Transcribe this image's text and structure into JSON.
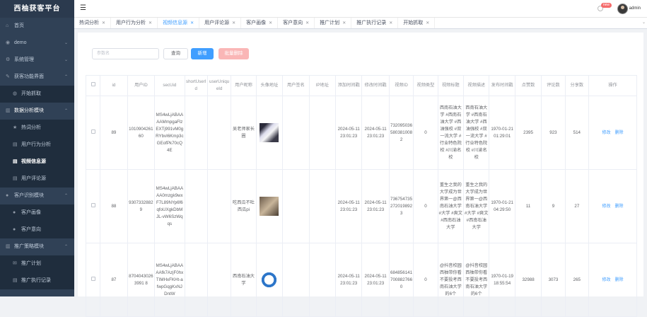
{
  "app": {
    "title": "西柚获客平台"
  },
  "sidebar": {
    "items": [
      {
        "label": "首页",
        "icon": "home-icon"
      },
      {
        "label": "demo",
        "icon": "dashboard-icon",
        "arrow": "⌄"
      },
      {
        "label": "系统管理",
        "icon": "gear-icon",
        "arrow": "⌄"
      },
      {
        "label": "获客功能界面",
        "icon": "tool-icon",
        "arrow": "⌃"
      },
      {
        "label": "开始抓取",
        "icon": "robot-icon"
      },
      {
        "label": "数据分析模块",
        "icon": "chart-icon",
        "arrow": "⌃"
      },
      {
        "label": "热词分析",
        "icon": "star-icon"
      },
      {
        "label": "用户行为分析",
        "icon": "document-icon"
      },
      {
        "label": "视频信息源",
        "icon": "document-icon"
      },
      {
        "label": "用户评论源",
        "icon": "document-icon"
      },
      {
        "label": "客户识别模块",
        "icon": "user-icon",
        "arrow": "⌃"
      },
      {
        "label": "客户画像",
        "icon": "user-icon"
      },
      {
        "label": "客户意向",
        "icon": "user-icon"
      },
      {
        "label": "推广策略模块",
        "icon": "chart-icon",
        "arrow": "⌃"
      },
      {
        "label": "推广计划",
        "icon": "mail-icon"
      },
      {
        "label": "推广执行记录",
        "icon": "document-icon"
      }
    ]
  },
  "header": {
    "user": "admin",
    "badge": "new"
  },
  "tabs": [
    "热词分析",
    "用户行为分析",
    "视频信息源",
    "用户评论源",
    "客户画像",
    "客户意向",
    "推广计划",
    "推广执行记录",
    "开始抓取"
  ],
  "toolbar": {
    "search_placeholder": "参数名",
    "query": "查询",
    "add": "新增",
    "batch_delete": "批量删除"
  },
  "table": {
    "headers": [
      "id",
      "用户ID",
      "secUid",
      "shortUserId",
      "userUniqueId",
      "用户昵称",
      "头像地址",
      "用户签名",
      "IP地址",
      "添加时间戳",
      "修改时间戳",
      "视频ID",
      "视频类型",
      "视频标题",
      "视频描述",
      "发布时间戳",
      "点赞数",
      "评论数",
      "分享数",
      "操作"
    ],
    "actions": {
      "edit": "修改",
      "delete": "删除"
    },
    "rows": [
      {
        "id": "89",
        "uid": "101090426160",
        "secUid": "MS4wLjABAAAAMmpgaFlzEXTj991vM0gRYbvI6Kmp3cGEofPk70cQ4E",
        "shortUserId": "",
        "userUniqueId": "",
        "nickname": "吴老师家长圈",
        "signature": "",
        "ip": "",
        "add_ts": "2024-05-11 23:01:23",
        "mod_ts": "2024-05-11 23:01:23",
        "video_id": "7320950365803810082",
        "video_type": "0",
        "title": "西南石油大学 #西南石油大学 #西油强校 #双一流大学 #行业特色院校 #川渝名校",
        "desc": "西南石油大学 #西南石油大学 #西油强校 #双一流大学 #行业特色院校 #川渝名校",
        "pub_ts": "1970-01-21 01:29:01",
        "likes": "2395",
        "comments": "923",
        "shares": "514"
      },
      {
        "id": "88",
        "uid": "93073328829",
        "secUid": "MS4wLjABAAAA0mzgk9wxF7L89NYp6f6qfoUXgkDbMJL-vW6SzWqqs",
        "shortUserId": "",
        "userUniqueId": "",
        "nickname": "吃西瓜不吐西瓜pi",
        "signature": "",
        "ip": "",
        "add_ts": "2024-05-11 23:01:23",
        "mod_ts": "2024-05-11 23:01:23",
        "video_id": "7367547352720198923",
        "video_type": "0",
        "title": "重生之我的大学成为世界第一@西南石油大学 #大学 #爽文 #西南石油大学",
        "desc": "重生之我的大学成为世界第一@西南石油大学 #大学 #爽文 #西南石油大学",
        "pub_ts": "1970-01-21 04:29:50",
        "likes": "11",
        "comments": "9",
        "shares": "27"
      },
      {
        "id": "87",
        "uid": "87040430263991 8",
        "secUid": "MS4wLjABAAAAfk7AzjF0hxTIMHxFKHt-afwpGqgKxNJDntW",
        "shortUserId": "",
        "userUniqueId": "",
        "nickname": "西南石油大学",
        "signature": "",
        "ip": "",
        "add_ts": "2024-05-11 23:01:23",
        "mod_ts": "2024-05-11 23:01:23",
        "video_id": "6848561417008827660",
        "video_type": "0",
        "title": "@抖音校园 西柚带你看不要投考西南石油大学的6个",
        "desc": "@抖音校园 西柚带你看不要投考西南石油大学的6个",
        "pub_ts": "1970-01-19 18:55:54",
        "likes": "32988",
        "comments": "3073",
        "shares": "265"
      }
    ]
  }
}
